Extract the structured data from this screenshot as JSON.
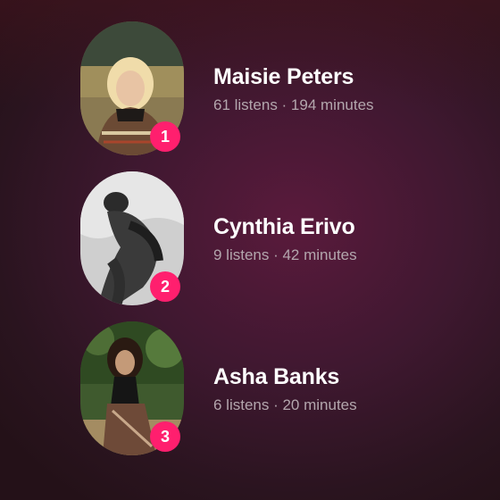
{
  "artists": [
    {
      "rank": "1",
      "name": "Maisie Peters",
      "stats": "61 listens · 194 minutes"
    },
    {
      "rank": "2",
      "name": "Cynthia Erivo",
      "stats": "9 listens · 42 minutes"
    },
    {
      "rank": "3",
      "name": "Asha Banks",
      "stats": "6 listens · 20 minutes"
    }
  ],
  "colors": {
    "badge": "#ff1f6e",
    "name_text": "#ffffff",
    "stats_text": "#b3a6ad",
    "background": "#3f1830"
  }
}
